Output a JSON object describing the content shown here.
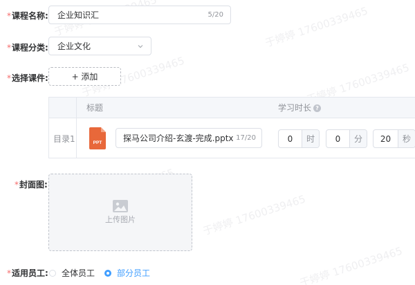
{
  "form": {
    "course_name": {
      "label": "课程名称:",
      "value": "企业知识汇",
      "count": "5/20"
    },
    "course_category": {
      "label": "课程分类:",
      "value": "企业文化"
    },
    "courseware": {
      "label": "选择课件:",
      "add_label": "+ 添加"
    },
    "table": {
      "col_title": "标题",
      "col_duration": "学习时长",
      "help": "?",
      "rows": [
        {
          "directory": "目录1",
          "file_badge": "PPT",
          "file_name": "探马公司介绍-玄渡-完成.pptx",
          "file_count": "17/20",
          "hours": "0",
          "hours_unit": "时",
          "minutes": "0",
          "minutes_unit": "分",
          "seconds": "20",
          "seconds_unit": "秒"
        }
      ]
    },
    "cover": {
      "label": "封面图:",
      "upload_label": "上传图片"
    },
    "employees": {
      "label": "适用员工:",
      "options": [
        {
          "label": "全体员工",
          "checked": false
        },
        {
          "label": "部分员工",
          "checked": true
        }
      ]
    },
    "required_mark": "*"
  },
  "watermark_text": "于婷婷 17600339465",
  "colors": {
    "primary": "#409eff",
    "required": "#f56c6c",
    "ppt": "#e8683a"
  }
}
